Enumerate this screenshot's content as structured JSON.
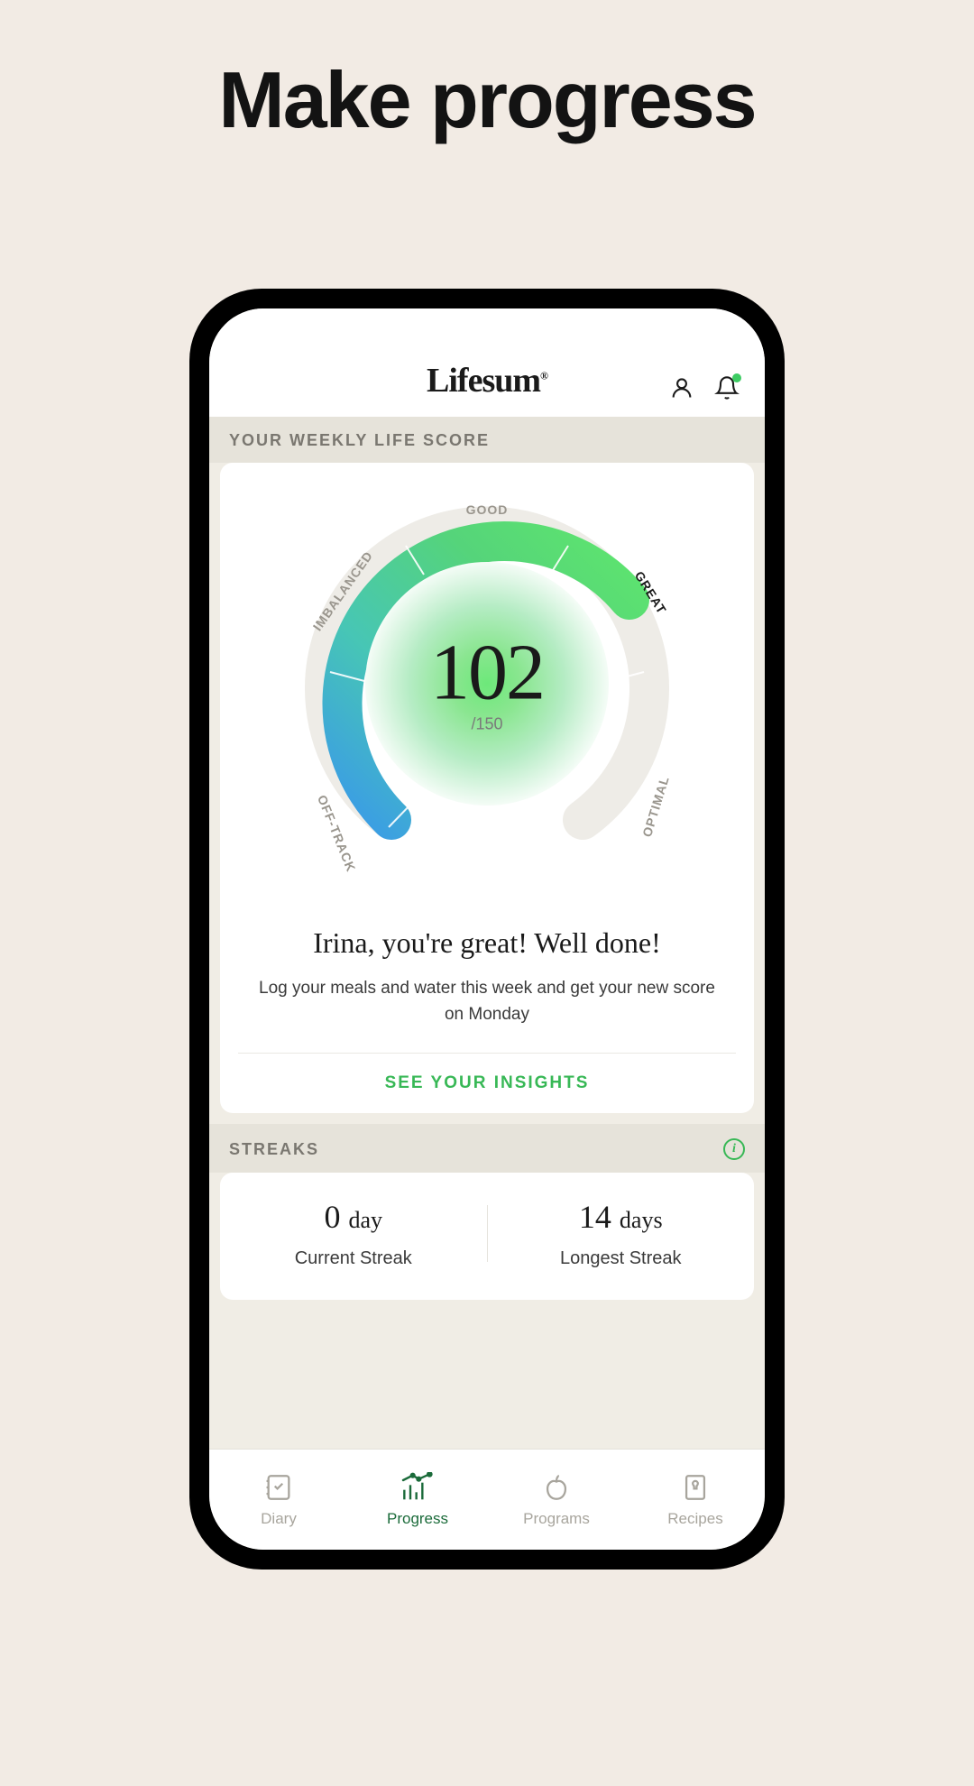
{
  "headline": "Make progress",
  "app": {
    "logo": "Lifesum",
    "logo_mark": "®"
  },
  "sections": {
    "score_label": "YOUR WEEKLY LIFE SCORE",
    "streaks_label": "STREAKS"
  },
  "gauge": {
    "value": "102",
    "max": "/150",
    "labels": {
      "good": "GOOD",
      "imbalanced": "IMBALANCED",
      "offtrack": "OFF-TRACK",
      "great": "GREAT",
      "optimal": "OPTIMAL"
    }
  },
  "greeting": "Irina, you're great! Well done!",
  "sub_message": "Log your meals and water this week and get your new score on Monday",
  "insights_link": "SEE YOUR INSIGHTS",
  "streaks": {
    "current": {
      "value": "0",
      "unit": "day",
      "label": "Current Streak"
    },
    "longest": {
      "value": "14",
      "unit": "days",
      "label": "Longest Streak"
    }
  },
  "tabs": {
    "diary": "Diary",
    "progress": "Progress",
    "programs": "Programs",
    "recipes": "Recipes"
  }
}
